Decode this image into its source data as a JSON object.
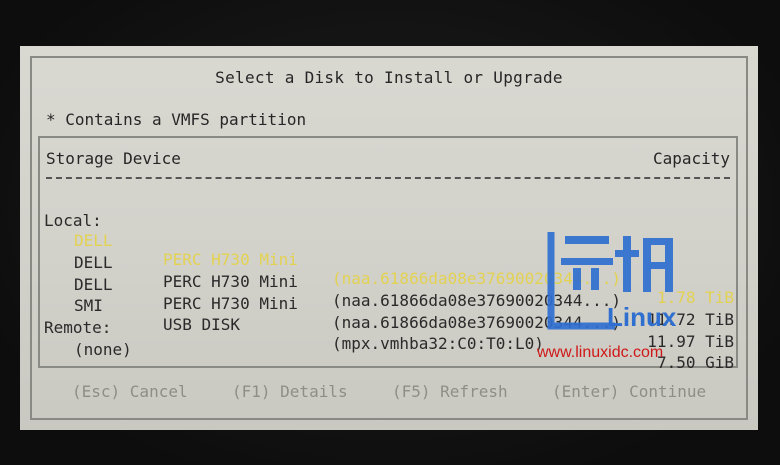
{
  "dialog": {
    "title": "Select a Disk to Install or Upgrade",
    "legend": "* Contains a VMFS partition"
  },
  "table": {
    "header_storage": "Storage Device",
    "header_capacity": "Capacity",
    "local_label": "Local:",
    "remote_label": "Remote:",
    "remote_none": "(none)",
    "local_rows": [
      {
        "vendor": "DELL",
        "model": "PERC H730 Mini",
        "path": "(naa.61866da08e37690020344...)",
        "capacity": "1.78 TiB",
        "selected": true
      },
      {
        "vendor": "DELL",
        "model": "PERC H730 Mini",
        "path": "(naa.61866da08e37690020344...)",
        "capacity": "11.72 TiB",
        "selected": false
      },
      {
        "vendor": "DELL",
        "model": "PERC H730 Mini",
        "path": "(naa.61866da08e37690020344...)",
        "capacity": "11.97 TiB",
        "selected": false
      },
      {
        "vendor": "SMI",
        "model": "USB DISK",
        "path": "(mpx.vmhba32:C0:T0:L0)",
        "capacity": "7.50 GiB",
        "selected": false
      }
    ]
  },
  "footer": {
    "cancel": "(Esc) Cancel",
    "details": "(F1) Details",
    "refresh": "(F5) Refresh",
    "continue": "(Enter) Continue"
  },
  "watermark": {
    "logo_text": "Linux",
    "url": "www.linuxidc.com"
  },
  "colors": {
    "dialog_bg": "#d4d3cc",
    "selected_text": "#e3d252",
    "footer_text": "#8e8e88",
    "watermark_blue": "#2f6fd0",
    "watermark_red": "#d01818"
  }
}
